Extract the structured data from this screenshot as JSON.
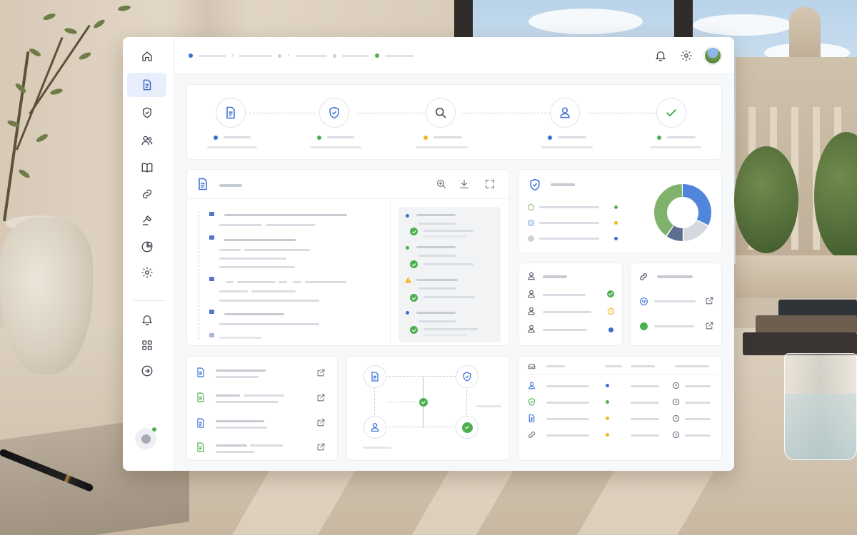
{
  "app": {
    "colors": {
      "accent": "#3b6fd6",
      "success": "#4caf50",
      "warning": "#f2b51c",
      "muted": "#d9dde3",
      "sidebar_active_bg": "#e8eefb"
    }
  },
  "sidebar": {
    "items": [
      {
        "icon": "home-icon",
        "active": false
      },
      {
        "icon": "document-icon",
        "active": true
      },
      {
        "icon": "shield-check-icon",
        "active": false
      },
      {
        "icon": "users-icon",
        "active": false
      },
      {
        "icon": "book-open-icon",
        "active": false
      },
      {
        "icon": "link-icon",
        "active": false
      },
      {
        "icon": "gavel-icon",
        "active": false
      },
      {
        "icon": "pie-chart-icon",
        "active": false
      },
      {
        "icon": "settings-icon",
        "active": false
      }
    ],
    "bottom_items": [
      {
        "icon": "bell-icon"
      },
      {
        "icon": "apps-grid-icon"
      },
      {
        "icon": "logout-arrow-icon"
      }
    ],
    "user_status": "online"
  },
  "topbar": {
    "breadcrumb_dot_colors": [
      "#3b6fd6",
      "#c7ccd3",
      "#c7ccd3",
      "#4caf50"
    ],
    "icons": [
      "bell-icon",
      "settings-icon",
      "avatar"
    ]
  },
  "workflow": {
    "steps": [
      {
        "icon": "document-icon",
        "status_color": "#3b6fd6"
      },
      {
        "icon": "shield-check-icon",
        "status_color": "#4caf50"
      },
      {
        "icon": "magnify-icon",
        "status_color": "#f2b51c"
      },
      {
        "icon": "user-icon",
        "status_color": "#3b6fd6"
      },
      {
        "icon": "check-icon",
        "status_color": "#4caf50"
      }
    ]
  },
  "document_viewer": {
    "toolbar_icons": [
      "zoom-in-icon",
      "download-icon",
      "fullscreen-icon"
    ],
    "review_items": [
      {
        "marker_color": "#3b6fd6",
        "state": "approved"
      },
      {
        "marker_color": "#4caf50",
        "state": "approved"
      },
      {
        "marker_color": "#f2b51c",
        "state": "approved",
        "flag": "warning"
      },
      {
        "marker_color": "#3b6fd6",
        "state": "approved"
      }
    ]
  },
  "compliance": {
    "legend": [
      {
        "color": "#7fb26a",
        "status_color": "#4caf50"
      },
      {
        "color": "#7fa3e0",
        "status_color": "#f2b51c"
      },
      {
        "color": "#cfd3d9",
        "status_color": "#3b6fd6"
      }
    ],
    "donut": {
      "segments": [
        {
          "color": "#4f86db",
          "value": 0.33
        },
        {
          "color": "#d5d9df",
          "value": 0.17
        },
        {
          "color": "#5c6e8e",
          "value": 0.1
        },
        {
          "color": "#7fb26a",
          "value": 0.4
        }
      ]
    }
  },
  "assignees": {
    "rows": [
      {
        "status_color": "#4caf50",
        "status": "check"
      },
      {
        "status_color": "#f2b51c",
        "status": "clock"
      },
      {
        "status_color": "#3b6fd6",
        "status": "dot"
      }
    ]
  },
  "links": {
    "rows": [
      {
        "icon": "shield-face-icon",
        "action": "external-link-icon"
      },
      {
        "icon": "success-dot-icon",
        "action": "external-link-icon"
      }
    ]
  },
  "files": {
    "rows": [
      {
        "icon_color": "#3b6fd6"
      },
      {
        "icon_color": "#4caf50"
      },
      {
        "icon_color": "#3b6fd6"
      },
      {
        "icon_color": "#4caf50"
      }
    ]
  },
  "activity": {
    "rows": [
      {
        "icon": "user-icon",
        "dot_color": "#3b6fd6"
      },
      {
        "icon": "shield-check-icon",
        "dot_color": "#4caf50"
      },
      {
        "icon": "document-icon",
        "dot_color": "#f2b51c"
      },
      {
        "icon": "link-icon",
        "dot_color": "#f2b51c"
      }
    ]
  }
}
